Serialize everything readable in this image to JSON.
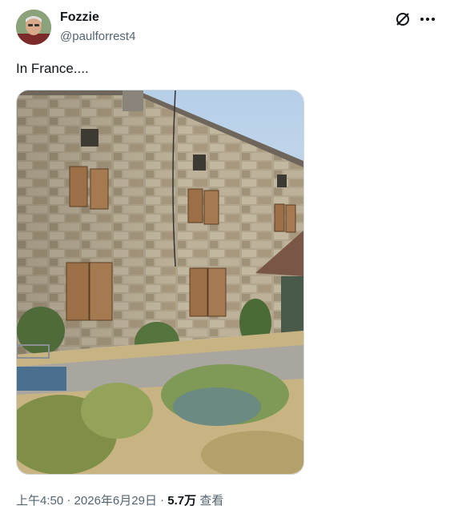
{
  "author": {
    "name": "Fozzie",
    "handle": "@paulforrest4"
  },
  "actions": {
    "grok_icon": "grok-slash-icon",
    "more_icon": "more-horizontal-icon"
  },
  "tweet": {
    "text": "In France....",
    "time": "上午4:50",
    "separator": "·",
    "date": "2026年6月29日",
    "views_count": "5.7万",
    "views_label": "查看"
  },
  "colors": {
    "text_primary": "#0f1419",
    "text_secondary": "#536471",
    "border": "#cfd9de"
  }
}
